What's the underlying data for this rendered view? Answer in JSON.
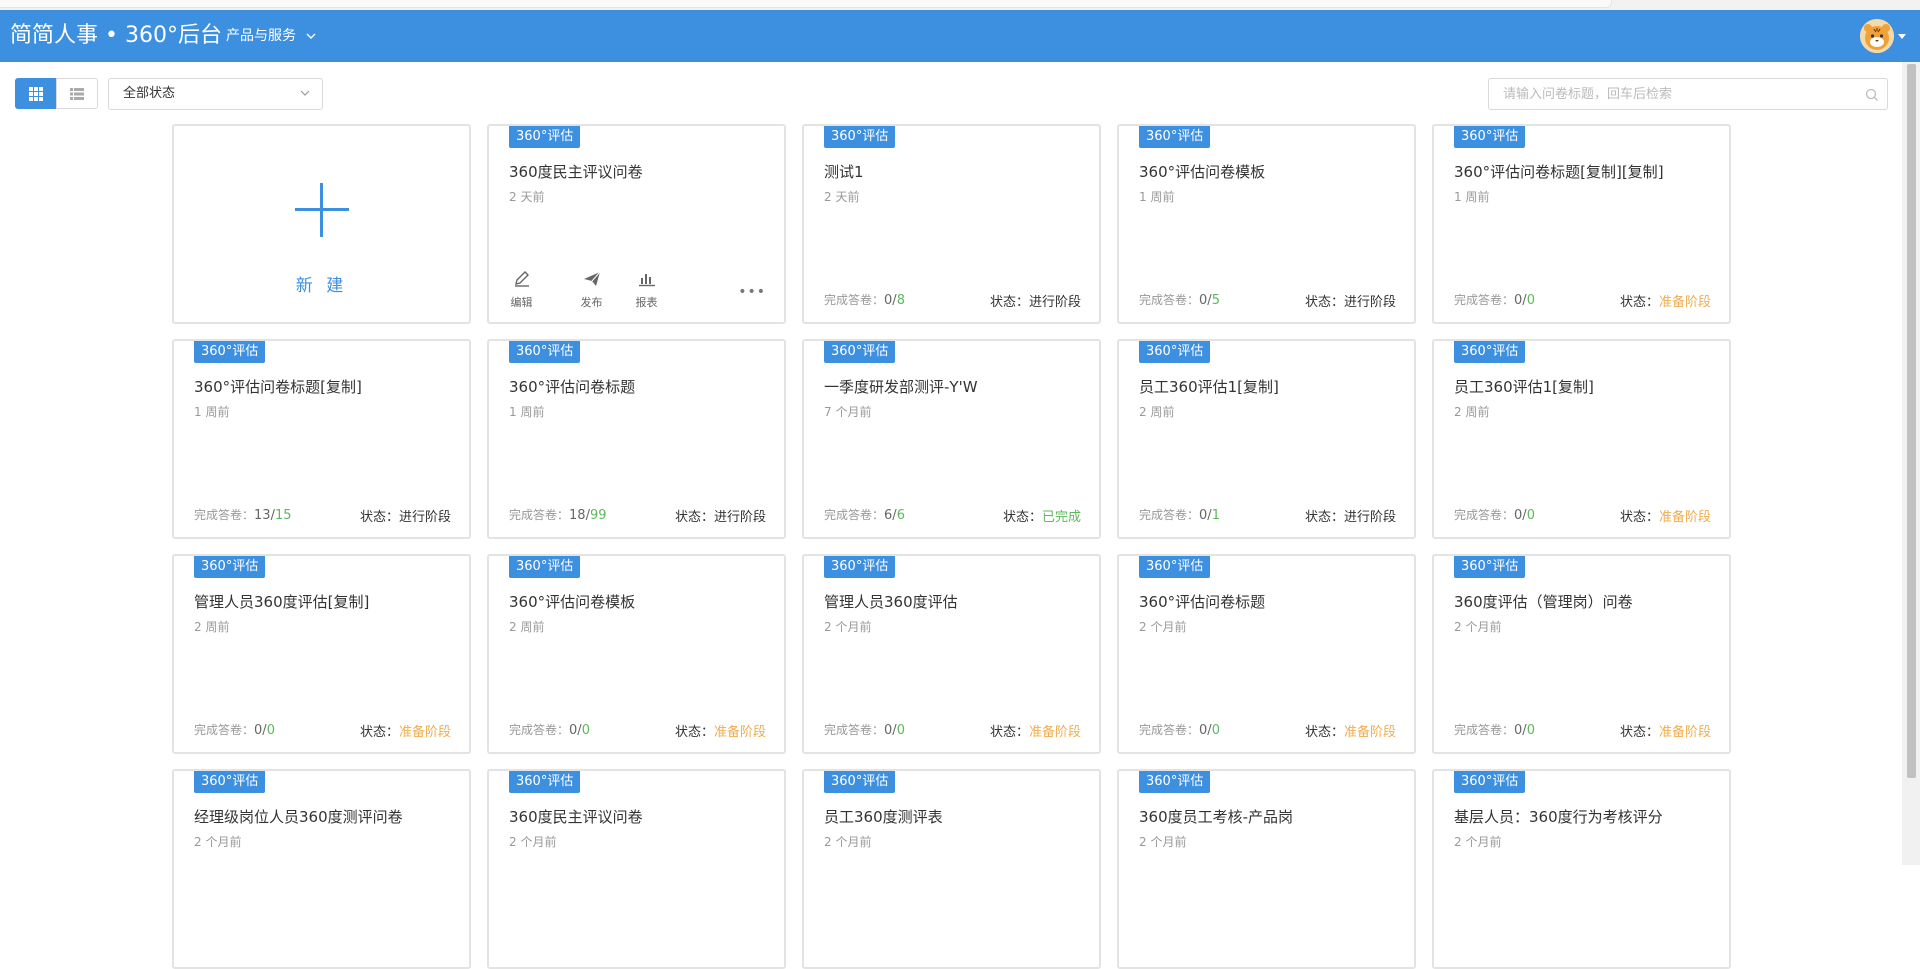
{
  "header": {
    "brand": "简简人事 • 360°后台",
    "nav_menu": "产品与服务",
    "accent": "#3d8fe0"
  },
  "toolbar": {
    "status_select": "全部状态",
    "search_placeholder": "请输入问卷标题，回车后检索"
  },
  "new_card": {
    "label": "新 建"
  },
  "labels": {
    "done_prefix": "完成答卷：",
    "status_prefix": "状态："
  },
  "colors": {
    "ongoing": "#333333",
    "preparing": "#f0ad4e",
    "completed": "#5cb85c"
  },
  "first_card_actions": [
    {
      "label": "编辑",
      "icon": "pencil-icon"
    },
    {
      "label": "发布",
      "icon": "send-icon"
    },
    {
      "label": "报表",
      "icon": "bar-chart-icon"
    }
  ],
  "cards": [
    {
      "tag": "360°评估",
      "title": "360度民主评议问卷",
      "time": "2 天前"
    },
    {
      "tag": "360°评估",
      "title": "测试1",
      "time": "2 天前",
      "done": "0",
      "total": "8",
      "status": "进行阶段",
      "state": "ongoing"
    },
    {
      "tag": "360°评估",
      "title": "360°评估问卷模板",
      "time": "1 周前",
      "done": "0",
      "total": "5",
      "status": "进行阶段",
      "state": "ongoing"
    },
    {
      "tag": "360°评估",
      "title": "360°评估问卷标题[复制][复制]",
      "time": "1 周前",
      "done": "0",
      "total": "0",
      "status": "准备阶段",
      "state": "preparing"
    },
    {
      "tag": "360°评估",
      "title": "360°评估问卷标题[复制]",
      "time": "1 周前",
      "done": "13",
      "total": "15",
      "status": "进行阶段",
      "state": "ongoing"
    },
    {
      "tag": "360°评估",
      "title": "360°评估问卷标题",
      "time": "1 周前",
      "done": "18",
      "total": "99",
      "status": "进行阶段",
      "state": "ongoing"
    },
    {
      "tag": "360°评估",
      "title": "一季度研发部测评-Y'W",
      "time": "7 个月前",
      "done": "6",
      "total": "6",
      "status": "已完成",
      "state": "completed"
    },
    {
      "tag": "360°评估",
      "title": "员工360评估1[复制]",
      "time": "2 周前",
      "done": "0",
      "total": "1",
      "status": "进行阶段",
      "state": "ongoing"
    },
    {
      "tag": "360°评估",
      "title": "员工360评估1[复制]",
      "time": "2 周前",
      "done": "0",
      "total": "0",
      "status": "准备阶段",
      "state": "preparing"
    },
    {
      "tag": "360°评估",
      "title": "管理人员360度评估[复制]",
      "time": "2 周前",
      "done": "0",
      "total": "0",
      "status": "准备阶段",
      "state": "preparing"
    },
    {
      "tag": "360°评估",
      "title": "360°评估问卷模板",
      "time": "2 周前",
      "done": "0",
      "total": "0",
      "status": "准备阶段",
      "state": "preparing"
    },
    {
      "tag": "360°评估",
      "title": "管理人员360度评估",
      "time": "2 个月前",
      "done": "0",
      "total": "0",
      "status": "准备阶段",
      "state": "preparing"
    },
    {
      "tag": "360°评估",
      "title": "360°评估问卷标题",
      "time": "2 个月前",
      "done": "0",
      "total": "0",
      "status": "准备阶段",
      "state": "preparing"
    },
    {
      "tag": "360°评估",
      "title": "360度评估（管理岗）问卷",
      "time": "2 个月前",
      "done": "0",
      "total": "0",
      "status": "准备阶段",
      "state": "preparing"
    },
    {
      "tag": "360°评估",
      "title": "经理级岗位人员360度测评问卷",
      "time": "2 个月前"
    },
    {
      "tag": "360°评估",
      "title": "360度民主评议问卷",
      "time": "2 个月前"
    },
    {
      "tag": "360°评估",
      "title": "员工360度测评表",
      "time": "2 个月前"
    },
    {
      "tag": "360°评估",
      "title": "360度员工考核-产品岗",
      "time": "2 个月前"
    },
    {
      "tag": "360°评估",
      "title": "基层人员：360度行为考核评分",
      "time": "2 个月前"
    }
  ]
}
